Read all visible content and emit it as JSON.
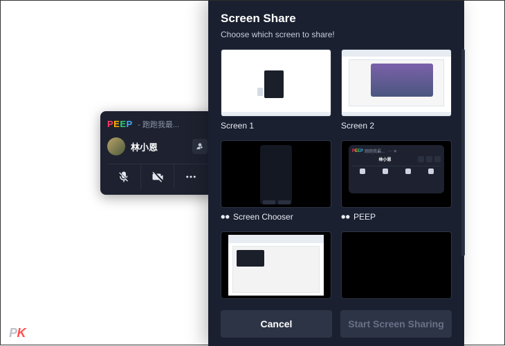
{
  "watermark": {
    "p": "P",
    "k": "K"
  },
  "call": {
    "logo": {
      "p1": "P",
      "p2": "E",
      "p3": "E",
      "p4": "P"
    },
    "title_suffix": " - 跑跑我最...",
    "user_name": "林小恩"
  },
  "dialog": {
    "title": "Screen Share",
    "subtitle": "Choose which screen to share!",
    "cancel": "Cancel",
    "start": "Start Screen Sharing",
    "sources": [
      {
        "label": "Screen 1",
        "has_app_icon": false
      },
      {
        "label": "Screen 2",
        "has_app_icon": false
      },
      {
        "label": "Screen Chooser",
        "has_app_icon": true
      },
      {
        "label": "PEEP",
        "has_app_icon": true
      },
      {
        "label": "",
        "has_app_icon": false
      },
      {
        "label": "",
        "has_app_icon": false
      }
    ]
  }
}
